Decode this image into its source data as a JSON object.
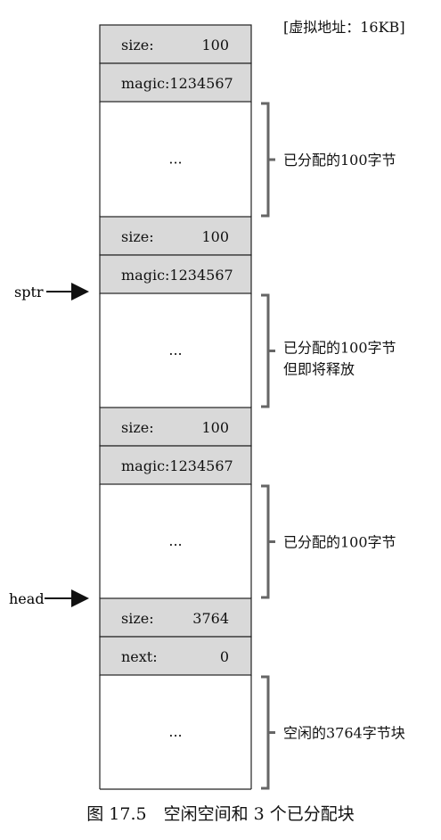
{
  "heap_label": "[虚拟地址：16KB]",
  "caption": "图 17.5　空闲空间和 3 个已分配块",
  "pointers": {
    "sptr": "sptr",
    "head": "head"
  },
  "blocks": [
    {
      "header_rows": [
        [
          "size:",
          "100"
        ],
        [
          "magic:1234567",
          ""
        ]
      ],
      "body_text": "...",
      "brace_label_lines": [
        "已分配的100字节"
      ]
    },
    {
      "header_rows": [
        [
          "size:",
          "100"
        ],
        [
          "magic:1234567",
          ""
        ]
      ],
      "body_text": "...",
      "brace_label_lines": [
        "已分配的100字节",
        "但即将释放"
      ]
    },
    {
      "header_rows": [
        [
          "size:",
          "100"
        ],
        [
          "magic:1234567",
          ""
        ]
      ],
      "body_text": "...",
      "brace_label_lines": [
        "已分配的100字节"
      ]
    },
    {
      "header_rows": [
        [
          "size:",
          "3764"
        ],
        [
          "next:",
          "0"
        ]
      ],
      "body_text": "...",
      "brace_label_lines": [
        "空闲的3764字节块"
      ]
    }
  ]
}
